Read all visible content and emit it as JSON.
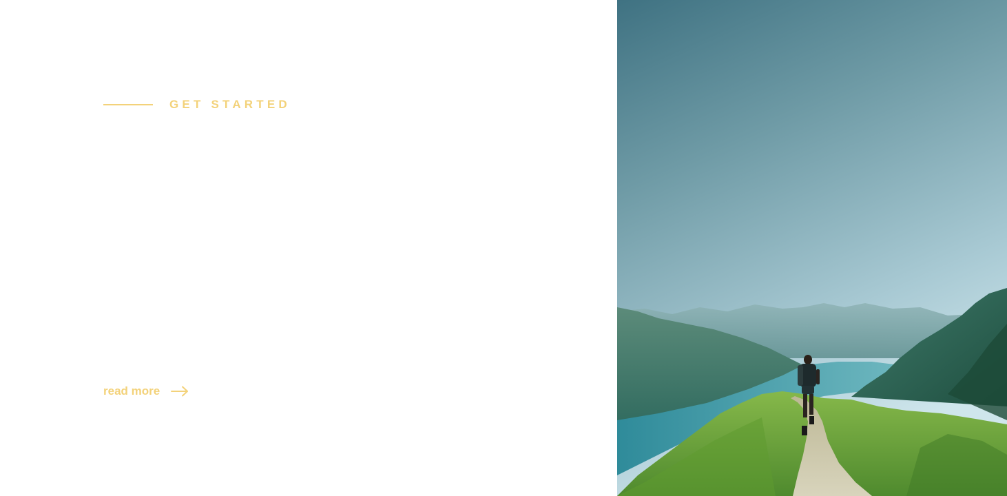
{
  "intro": {
    "eyebrow_label": "GET STARTED",
    "read_more_label": "read more"
  },
  "colors": {
    "accent": "#f3d27a",
    "sky_top": "#3f7282",
    "sky_bottom": "#bdd9e2",
    "grass": "#6fa23c",
    "lake": "#3b9aa6"
  },
  "icons": {
    "read_more": "arrow-right-icon"
  }
}
